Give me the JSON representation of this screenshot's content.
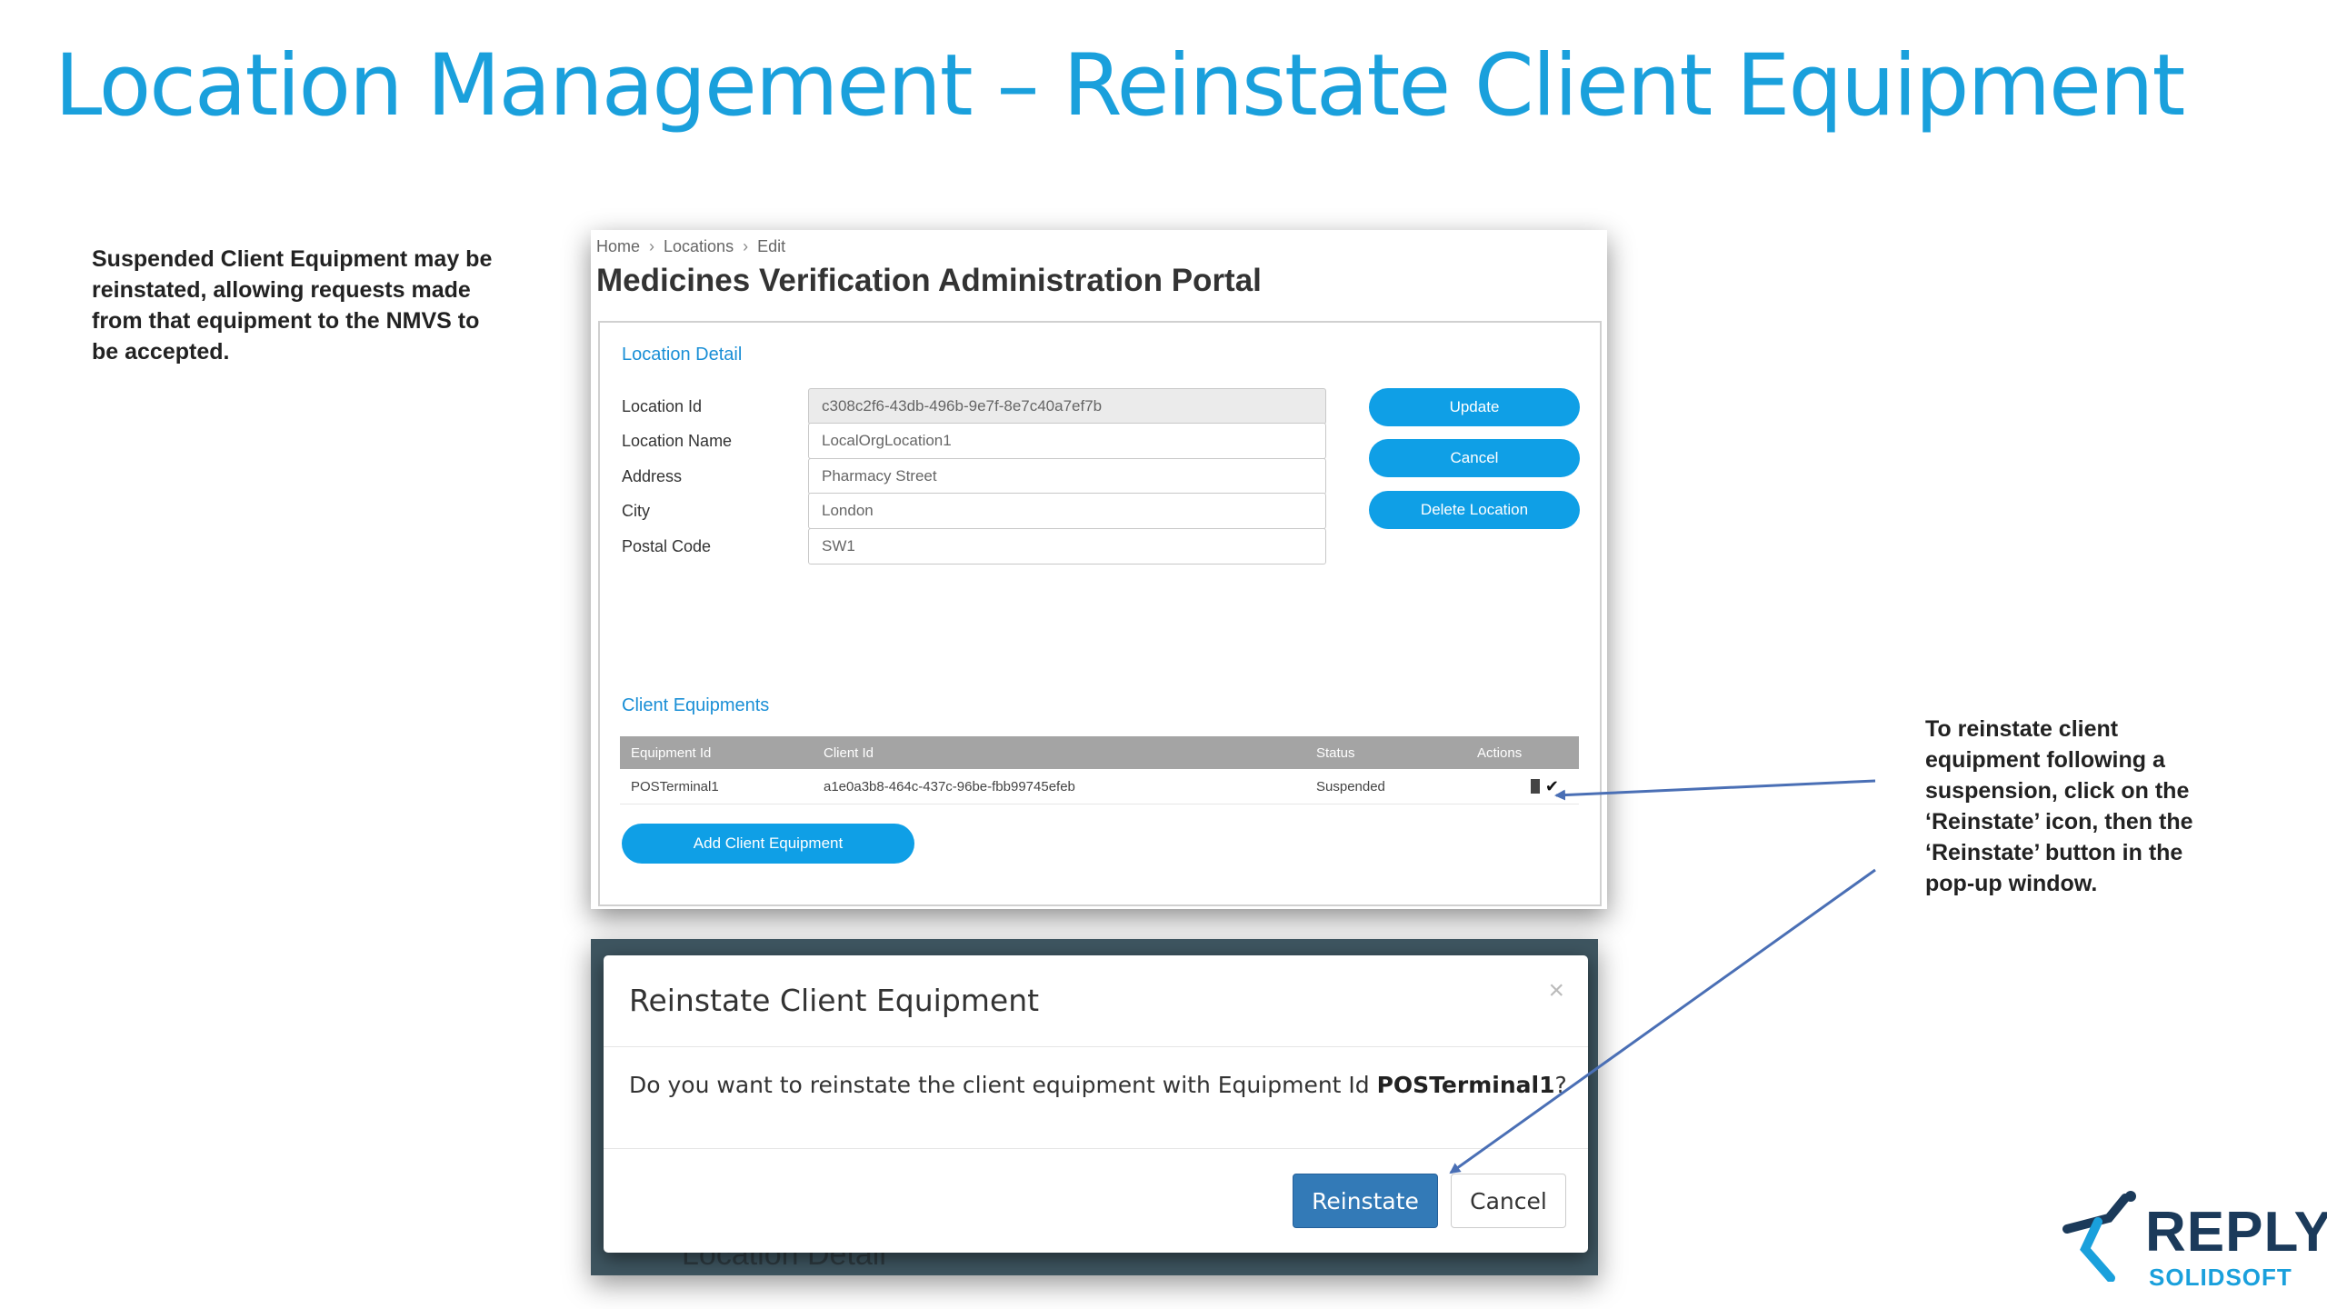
{
  "slide": {
    "title": "Location Management – Reinstate Client Equipment",
    "left_note": "Suspended Client Equipment may be reinstated, allowing requests made from that equipment to the NMVS to be accepted.",
    "right_note": "To reinstate client equipment following a suspension, click on the ‘Reinstate’ icon, then the ‘Reinstate’ button in the pop-up window."
  },
  "portal": {
    "breadcrumb": [
      "Home",
      "Locations",
      "Edit"
    ],
    "title": "Medicines Verification Administration Portal",
    "location_detail": {
      "section_title": "Location Detail",
      "fields": {
        "location_id": {
          "label": "Location Id",
          "value": "c308c2f6-43db-496b-9e7f-8e7c40a7ef7b"
        },
        "location_name": {
          "label": "Location Name",
          "value": "LocalOrgLocation1"
        },
        "address": {
          "label": "Address",
          "value": "Pharmacy Street"
        },
        "city": {
          "label": "City",
          "value": "London"
        },
        "postal_code": {
          "label": "Postal Code",
          "value": "SW1"
        }
      }
    },
    "buttons": {
      "update": "Update",
      "cancel": "Cancel",
      "delete": "Delete Location"
    },
    "client_equipments": {
      "section_title": "Client Equipments",
      "headers": {
        "equipment_id": "Equipment Id",
        "client_id": "Client Id",
        "status": "Status",
        "actions": "Actions"
      },
      "rows": [
        {
          "equipment_id": "POSTerminal1",
          "client_id": "a1e0a3b8-464c-437c-96be-fbb99745efeb",
          "status": "Suspended"
        }
      ],
      "add_button": "Add Client Equipment"
    }
  },
  "modal": {
    "title": "Reinstate Client Equipment",
    "close_symbol": "×",
    "body_prefix": "Do you want to reinstate the client equipment with Equipment Id ",
    "body_equipment_id": "POSTerminal1",
    "body_suffix": "?",
    "reinstate_button": "Reinstate",
    "cancel_button": "Cancel",
    "background_text": "Location Detail"
  },
  "logo": {
    "word": "REPLY",
    "sub": "SOLIDSOFT"
  },
  "colors": {
    "title_blue": "#1aa0dc",
    "portal_button_blue": "#0f9fe6",
    "modal_primary": "#337ab7",
    "arrow_blue": "#4a6fb5",
    "logo_navy": "#1b3a5a"
  },
  "icons": {
    "trash": "trash-icon",
    "reinstate": "check-icon",
    "close": "close-icon",
    "logo": "runner-icon"
  }
}
